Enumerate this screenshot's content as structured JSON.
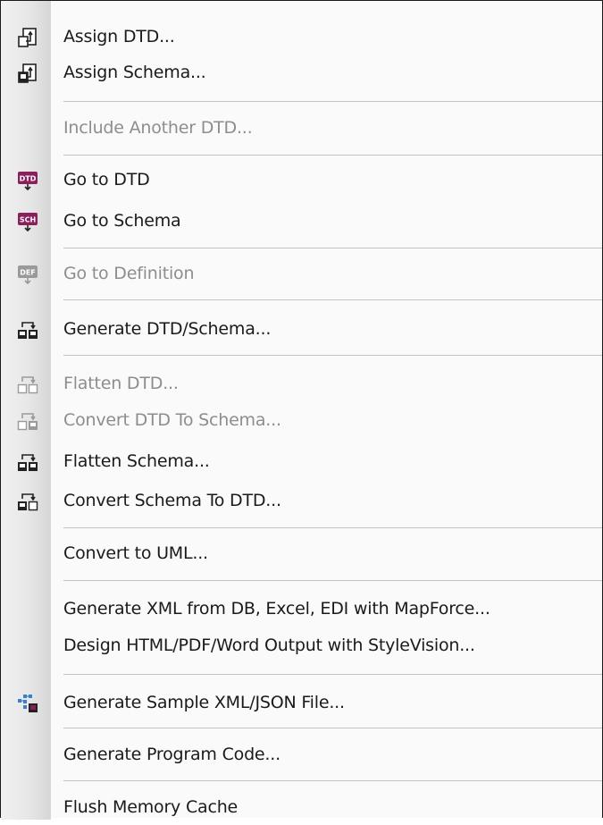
{
  "menu": {
    "items": [
      {
        "label": "Assign DTD...",
        "icon": "assign-doc-icon",
        "enabled": true
      },
      {
        "label": "Assign Schema...",
        "icon": "assign-doc-icon",
        "enabled": true
      },
      {
        "label": "Include Another DTD...",
        "icon": "",
        "enabled": false
      },
      {
        "label": "Go to DTD",
        "icon": "dtd-icon",
        "enabled": true
      },
      {
        "label": "Go to Schema",
        "icon": "sch-icon",
        "enabled": true
      },
      {
        "label": "Go to Definition",
        "icon": "def-icon",
        "enabled": false
      },
      {
        "label": "Generate DTD/Schema...",
        "icon": "generate-icon",
        "enabled": true
      },
      {
        "label": "Flatten DTD...",
        "icon": "flatten-icon",
        "enabled": false
      },
      {
        "label": "Convert DTD To Schema...",
        "icon": "convert-icon",
        "enabled": false
      },
      {
        "label": "Flatten Schema...",
        "icon": "flatten-icon",
        "enabled": true
      },
      {
        "label": "Convert Schema To DTD...",
        "icon": "convert-icon",
        "enabled": true
      },
      {
        "label": "Convert to UML...",
        "icon": "",
        "enabled": true
      },
      {
        "label": "Generate XML from DB, Excel, EDI with MapForce...",
        "icon": "",
        "enabled": true
      },
      {
        "label": "Design HTML/PDF/Word Output with StyleVision...",
        "icon": "",
        "enabled": true
      },
      {
        "label": "Generate Sample XML/JSON File...",
        "icon": "sample-xml-icon",
        "enabled": true
      },
      {
        "label": "Generate Program Code...",
        "icon": "",
        "enabled": true
      },
      {
        "label": "Flush Memory Cache",
        "icon": "",
        "enabled": true
      }
    ],
    "icon_text": {
      "dtd": "DTD",
      "sch": "SCH",
      "def": "DEF"
    },
    "colors": {
      "icon_magenta": "#8a1f5c",
      "disabled_text": "#8d8d8d",
      "separator": "#c4c4c4"
    }
  }
}
